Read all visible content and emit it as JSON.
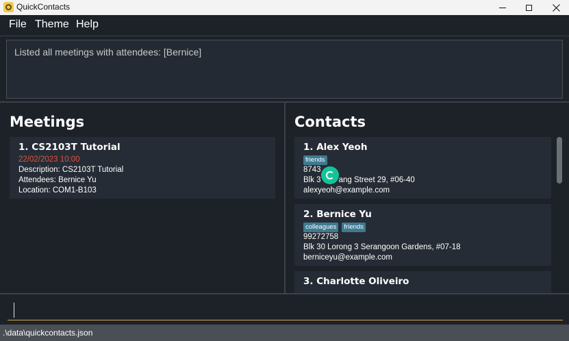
{
  "window": {
    "title": "QuickContacts"
  },
  "menu": {
    "file": "File",
    "theme": "Theme",
    "help": "Help"
  },
  "result": {
    "text": "Listed all meetings with attendees: [Bernice]"
  },
  "meetings": {
    "title": "Meetings",
    "items": [
      {
        "title": "1.  CS2103T Tutorial",
        "datetime": "22/02/2023 10:00",
        "description": "Description: CS2103T Tutorial",
        "attendees": "Attendees: Bernice Yu",
        "location": "Location: COM1-B103"
      }
    ]
  },
  "contacts": {
    "title": "Contacts",
    "items": [
      {
        "name": "1.  Alex Yeoh",
        "tags": [
          "friends"
        ],
        "phone": "8743",
        "address_start": "Blk 3",
        "address_end": "ang Street 29, #06-40",
        "email": "alexyeoh@example.com"
      },
      {
        "name": "2.  Bernice Yu",
        "tags": [
          "colleagues",
          "friends"
        ],
        "phone": "99272758",
        "address": "Blk 30 Lorong 3 Serangoon Gardens, #07-18",
        "email": "berniceyu@example.com"
      },
      {
        "name": "3.  Charlotte Oliveiro"
      }
    ]
  },
  "command": {
    "value": ""
  },
  "status": {
    "path": ".\\data\\quickcontacts.json"
  },
  "colors": {
    "accent_date": "#e0533b",
    "tag": "#3e7b91",
    "background": "#1d2229",
    "card": "#262c35",
    "grammarly": "#15c39a"
  },
  "icons": {
    "app": "quickcontacts-app-icon",
    "grammarly": "grammarly-icon"
  }
}
